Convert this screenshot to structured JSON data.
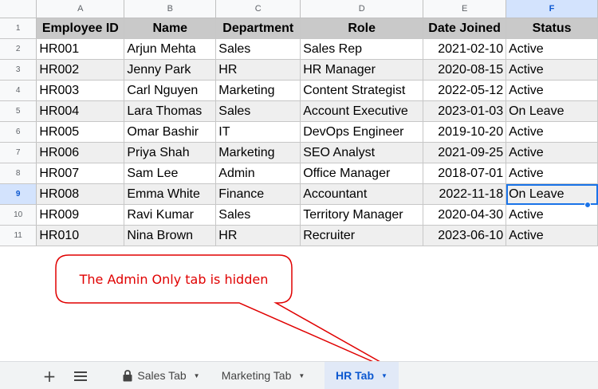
{
  "columns": [
    "A",
    "B",
    "C",
    "D",
    "E",
    "F"
  ],
  "selected_column": "F",
  "selected_row": 9,
  "header_row": {
    "row_number": "1",
    "cells": [
      "Employee ID",
      "Name",
      "Department",
      "Role",
      "Date Joined",
      "Status"
    ]
  },
  "rows": [
    {
      "row_number": "2",
      "cells": [
        "HR001",
        "Arjun Mehta",
        "Sales",
        "Sales Rep",
        "2021-02-10",
        "Active"
      ]
    },
    {
      "row_number": "3",
      "cells": [
        "HR002",
        "Jenny Park",
        "HR",
        "HR Manager",
        "2020-08-15",
        "Active"
      ]
    },
    {
      "row_number": "4",
      "cells": [
        "HR003",
        "Carl Nguyen",
        "Marketing",
        "Content Strategist",
        "2022-05-12",
        "Active"
      ]
    },
    {
      "row_number": "5",
      "cells": [
        "HR004",
        "Lara Thomas",
        "Sales",
        "Account Executive",
        "2023-01-03",
        "On Leave"
      ]
    },
    {
      "row_number": "6",
      "cells": [
        "HR005",
        "Omar Bashir",
        "IT",
        "DevOps Engineer",
        "2019-10-20",
        "Active"
      ]
    },
    {
      "row_number": "7",
      "cells": [
        "HR006",
        "Priya Shah",
        "Marketing",
        "SEO Analyst",
        "2021-09-25",
        "Active"
      ]
    },
    {
      "row_number": "8",
      "cells": [
        "HR007",
        "Sam Lee",
        "Admin",
        "Office Manager",
        "2018-07-01",
        "Active"
      ]
    },
    {
      "row_number": "9",
      "cells": [
        "HR008",
        "Emma White",
        "Finance",
        "Accountant",
        "2022-11-18",
        "On Leave"
      ]
    },
    {
      "row_number": "10",
      "cells": [
        "HR009",
        "Ravi Kumar",
        "Sales",
        "Territory Manager",
        "2020-04-30",
        "Active"
      ]
    },
    {
      "row_number": "11",
      "cells": [
        "HR010",
        "Nina Brown",
        "HR",
        "Recruiter",
        "2023-06-10",
        "Active"
      ]
    }
  ],
  "callout": {
    "text": "The Admin Only tab is hidden",
    "color": "#e00000"
  },
  "bottom_bar": {
    "add_icon": "+",
    "menu_icon": "list-icon",
    "tabs": [
      {
        "label": "Sales Tab",
        "locked": true,
        "active": false
      },
      {
        "label": "Marketing Tab",
        "locked": false,
        "active": false
      },
      {
        "label": "HR Tab",
        "locked": false,
        "active": true
      }
    ]
  },
  "colors": {
    "header_fill": "#c9c9c9",
    "band_fill": "#efefef",
    "selection_blue": "#1a73e8",
    "active_tab_bg": "#e1e9f7",
    "active_tab_text": "#0b57d0"
  }
}
